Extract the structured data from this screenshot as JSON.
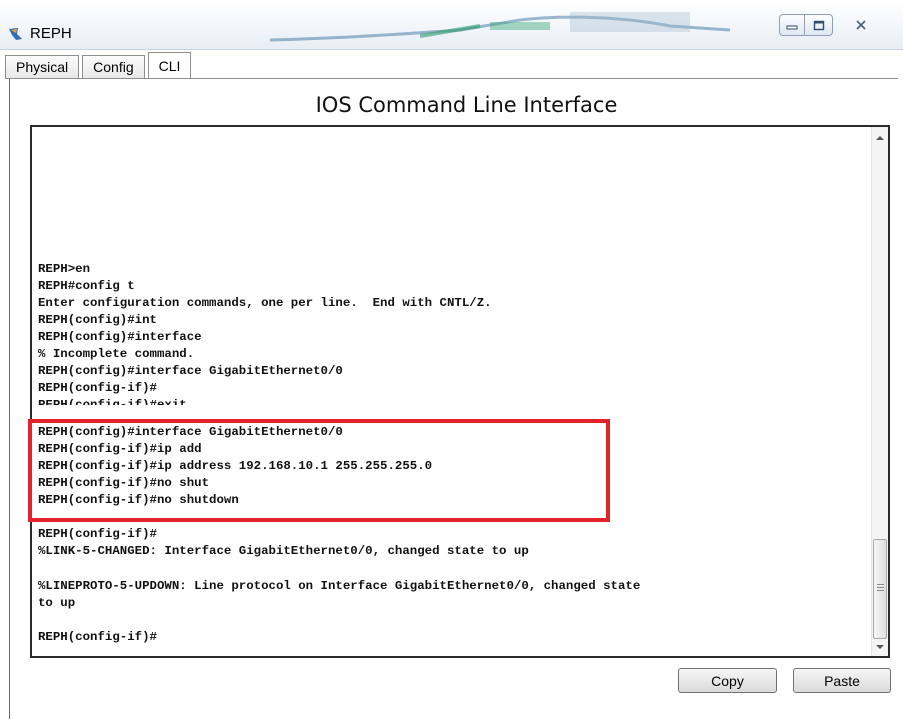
{
  "window": {
    "title": "REPH",
    "controls": {
      "minimize": "minimize-icon",
      "maximize": "maximize-icon",
      "close": "close-icon"
    }
  },
  "tabs": [
    {
      "label": "Physical",
      "active": false
    },
    {
      "label": "Config",
      "active": false
    },
    {
      "label": "CLI",
      "active": true
    }
  ],
  "cli": {
    "heading": "IOS Command Line Interface",
    "lines": [
      "REPH>en",
      "REPH#config t",
      "Enter configuration commands, one per line.  End with CNTL/Z.",
      "REPH(config)#int",
      "REPH(config)#interface",
      "% Incomplete command.",
      "REPH(config)#interface GigabitEthernet0/0",
      "REPH(config-if)#",
      "REPH(config-if)#exit",
      "REPH(config)#interface GigabitEthernet0/0",
      "REPH(config-if)#ip add",
      "REPH(config-if)#ip address 192.168.10.1 255.255.255.0",
      "REPH(config-if)#no shut",
      "REPH(config-if)#no shutdown",
      "",
      "REPH(config-if)#",
      "%LINK-5-CHANGED: Interface GigabitEthernet0/0, changed state to up",
      "",
      "%LINEPROTO-5-UPDOWN: Line protocol on Interface GigabitEthernet0/0, changed state",
      "to up",
      "",
      "REPH(config-if)#"
    ],
    "highlight_color": "#e3222c"
  },
  "buttons": {
    "copy_label": "Copy",
    "paste_label": "Paste"
  },
  "colors": {
    "highlight": "#e3222c",
    "terminal_border": "#2b2b2b",
    "text": "#111111"
  }
}
